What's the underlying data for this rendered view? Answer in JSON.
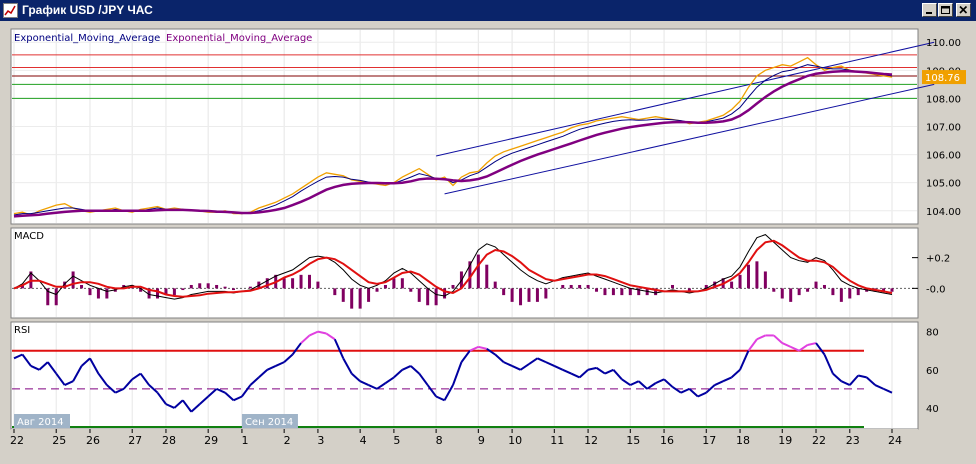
{
  "window": {
    "title": "График USD /JPY ЧАС",
    "buttons": [
      "minimize",
      "maximize",
      "close"
    ]
  },
  "chart_data": [
    {
      "panel": "price",
      "type": "line",
      "indicator_labels": [
        "Exponential_Moving_Average",
        "Exponential_Moving_Average"
      ],
      "label_colors": [
        "#000080",
        "#800080"
      ],
      "ylim": [
        103.6,
        110.4
      ],
      "yticks": [
        "110.00",
        "109.00",
        "108.00",
        "107.00",
        "106.00",
        "105.00",
        "104.00"
      ],
      "last_price": "108.76",
      "x_index_range": [
        0,
        104
      ],
      "series": [
        {
          "name": "price",
          "color": "#f0a000",
          "values": [
            103.9,
            103.95,
            103.85,
            104.0,
            104.1,
            104.2,
            104.25,
            104.1,
            104.0,
            103.95,
            104.0,
            104.05,
            104.1,
            104.0,
            103.95,
            104.05,
            104.1,
            104.15,
            104.05,
            104.1,
            104.05,
            104.0,
            104.0,
            103.95,
            103.95,
            104.0,
            103.9,
            103.9,
            103.95,
            104.1,
            104.2,
            104.3,
            104.45,
            104.6,
            104.8,
            105.0,
            105.2,
            105.35,
            105.3,
            105.25,
            105.1,
            105.05,
            105.0,
            104.95,
            104.9,
            105.0,
            105.2,
            105.35,
            105.5,
            105.3,
            105.1,
            105.2,
            104.9,
            105.2,
            105.35,
            105.4,
            105.7,
            105.95,
            106.1,
            106.2,
            106.3,
            106.4,
            106.5,
            106.6,
            106.7,
            106.8,
            106.95,
            107.05,
            107.1,
            107.2,
            107.25,
            107.3,
            107.35,
            107.3,
            107.25,
            107.3,
            107.35,
            107.3,
            107.25,
            107.2,
            107.1,
            107.15,
            107.2,
            107.3,
            107.4,
            107.6,
            107.9,
            108.4,
            108.8,
            109.0,
            109.1,
            109.2,
            109.15,
            109.3,
            109.45,
            109.2,
            109.0,
            109.1,
            109.15,
            109.0,
            108.95,
            108.9,
            108.85,
            108.8,
            108.76
          ]
        },
        {
          "name": "",
          "color": "#000080",
          "values": [
            103.85,
            103.9,
            103.9,
            103.95,
            104.0,
            104.05,
            104.1,
            104.1,
            104.05,
            104.0,
            104.0,
            104.0,
            104.05,
            104.0,
            104.0,
            104.0,
            104.05,
            104.1,
            104.05,
            104.05,
            104.05,
            104.0,
            104.0,
            103.98,
            103.95,
            103.95,
            103.92,
            103.9,
            103.93,
            104.0,
            104.1,
            104.2,
            104.35,
            104.5,
            104.7,
            104.88,
            105.05,
            105.2,
            105.22,
            105.2,
            105.12,
            105.08,
            105.02,
            104.98,
            104.95,
            104.98,
            105.08,
            105.2,
            105.32,
            105.25,
            105.15,
            105.15,
            105.0,
            105.1,
            105.25,
            105.35,
            105.55,
            105.75,
            105.92,
            106.05,
            106.15,
            106.25,
            106.35,
            106.45,
            106.55,
            106.65,
            106.78,
            106.9,
            106.98,
            107.05,
            107.12,
            107.18,
            107.22,
            107.24,
            107.22,
            107.23,
            107.26,
            107.26,
            107.24,
            107.21,
            107.15,
            107.14,
            107.17,
            107.23,
            107.3,
            107.45,
            107.68,
            108.05,
            108.4,
            108.65,
            108.82,
            108.95,
            109.0,
            109.1,
            109.2,
            109.15,
            109.08,
            109.05,
            109.05,
            109.0,
            108.95,
            108.92,
            108.88,
            108.85,
            108.8
          ]
        },
        {
          "name": "",
          "color": "#800080",
          "values": [
            103.8,
            103.82,
            103.84,
            103.86,
            103.9,
            103.93,
            103.96,
            103.98,
            104.0,
            104.0,
            104.0,
            104.0,
            104.0,
            104.0,
            104.0,
            104.0,
            104.0,
            104.02,
            104.03,
            104.03,
            104.03,
            104.02,
            104.0,
            103.99,
            103.97,
            103.96,
            103.94,
            103.92,
            103.92,
            103.94,
            103.98,
            104.03,
            104.1,
            104.2,
            104.32,
            104.45,
            104.6,
            104.75,
            104.85,
            104.92,
            104.96,
            104.98,
            104.99,
            104.99,
            104.98,
            104.98,
            105.0,
            105.05,
            105.12,
            105.15,
            105.14,
            105.12,
            105.08,
            105.06,
            105.08,
            105.13,
            105.22,
            105.36,
            105.5,
            105.64,
            105.77,
            105.89,
            106.0,
            106.1,
            106.2,
            106.3,
            106.4,
            106.5,
            106.6,
            106.7,
            106.78,
            106.85,
            106.92,
            106.98,
            107.02,
            107.06,
            107.1,
            107.13,
            107.15,
            107.16,
            107.15,
            107.13,
            107.13,
            107.15,
            107.18,
            107.25,
            107.38,
            107.58,
            107.82,
            108.05,
            108.25,
            108.42,
            108.56,
            108.68,
            108.8,
            108.88,
            108.92,
            108.95,
            108.97,
            108.97,
            108.95,
            108.93,
            108.9,
            108.87,
            108.85
          ]
        }
      ],
      "hlines": [
        {
          "value": 109.55,
          "color": "#e03030"
        },
        {
          "value": 109.1,
          "color": "#e03030"
        },
        {
          "value": 108.8,
          "color": "#800000"
        },
        {
          "value": 108.5,
          "color": "#20a020"
        },
        {
          "value": 108.0,
          "color": "#20a020"
        }
      ],
      "trendlines": [
        {
          "from": [
            50,
            105.95
          ],
          "to": [
            109,
            110.0
          ],
          "color": "#1010a0"
        },
        {
          "from": [
            51,
            104.6
          ],
          "to": [
            109,
            108.5
          ],
          "color": "#1010a0"
        }
      ]
    },
    {
      "panel": "macd",
      "type": "line",
      "label": "MACD",
      "ylim": [
        -0.18,
        0.38
      ],
      "yticks": [
        "+0.2",
        "-0.0"
      ],
      "series": [
        {
          "name": "",
          "color": "#000000",
          "values": [
            0.0,
            0.03,
            0.1,
            0.05,
            -0.02,
            -0.04,
            0.03,
            0.08,
            0.05,
            0.02,
            0.0,
            -0.02,
            -0.01,
            0.01,
            0.02,
            0.0,
            -0.04,
            -0.05,
            -0.06,
            -0.07,
            -0.06,
            -0.04,
            -0.03,
            -0.02,
            -0.02,
            -0.02,
            -0.03,
            -0.02,
            -0.01,
            0.02,
            0.05,
            0.08,
            0.1,
            0.12,
            0.16,
            0.2,
            0.21,
            0.2,
            0.17,
            0.12,
            0.06,
            0.02,
            0.0,
            0.02,
            0.05,
            0.1,
            0.13,
            0.1,
            0.05,
            0.0,
            -0.04,
            -0.05,
            -0.02,
            0.05,
            0.15,
            0.25,
            0.29,
            0.27,
            0.22,
            0.17,
            0.12,
            0.08,
            0.05,
            0.03,
            0.05,
            0.07,
            0.08,
            0.09,
            0.1,
            0.08,
            0.06,
            0.04,
            0.02,
            0.0,
            -0.01,
            -0.02,
            -0.03,
            -0.02,
            -0.01,
            -0.02,
            -0.03,
            -0.02,
            0.0,
            0.03,
            0.06,
            0.08,
            0.14,
            0.24,
            0.33,
            0.35,
            0.3,
            0.25,
            0.2,
            0.18,
            0.17,
            0.2,
            0.18,
            0.12,
            0.05,
            0.02,
            0.0,
            -0.01,
            -0.02,
            -0.03,
            -0.04
          ]
        },
        {
          "name": "",
          "color": "#e01010",
          "values": [
            0.0,
            0.02,
            0.05,
            0.05,
            0.03,
            0.01,
            0.01,
            0.03,
            0.04,
            0.04,
            0.03,
            0.01,
            0.0,
            0.0,
            0.01,
            0.01,
            -0.01,
            -0.02,
            -0.04,
            -0.05,
            -0.055,
            -0.05,
            -0.045,
            -0.035,
            -0.03,
            -0.025,
            -0.025,
            -0.02,
            -0.015,
            0.0,
            0.02,
            0.04,
            0.07,
            0.09,
            0.12,
            0.16,
            0.19,
            0.2,
            0.19,
            0.16,
            0.12,
            0.08,
            0.04,
            0.03,
            0.04,
            0.07,
            0.1,
            0.11,
            0.09,
            0.05,
            0.01,
            -0.02,
            -0.03,
            0.0,
            0.07,
            0.15,
            0.22,
            0.25,
            0.24,
            0.21,
            0.17,
            0.12,
            0.09,
            0.06,
            0.05,
            0.06,
            0.07,
            0.08,
            0.09,
            0.09,
            0.08,
            0.06,
            0.04,
            0.02,
            0.01,
            0.0,
            -0.01,
            -0.02,
            -0.02,
            -0.02,
            -0.02,
            -0.02,
            -0.01,
            0.01,
            0.03,
            0.06,
            0.1,
            0.17,
            0.25,
            0.3,
            0.31,
            0.28,
            0.24,
            0.2,
            0.18,
            0.18,
            0.17,
            0.14,
            0.09,
            0.05,
            0.02,
            0.0,
            -0.01,
            -0.02,
            -0.03
          ]
        }
      ],
      "histogram_color": "#800060",
      "zero_line_color": "#606060"
    },
    {
      "panel": "rsi",
      "type": "line",
      "label": "RSI",
      "ylim": [
        30,
        84
      ],
      "yticks": [
        "80",
        "60",
        "40"
      ],
      "series": [
        {
          "name": "",
          "color": "#0000a0",
          "overbought_color": "#e040e0",
          "values": [
            66,
            68,
            62,
            60,
            64,
            58,
            52,
            54,
            62,
            66,
            58,
            52,
            48,
            50,
            55,
            58,
            52,
            48,
            42,
            40,
            44,
            38,
            42,
            46,
            50,
            48,
            44,
            46,
            52,
            56,
            60,
            62,
            64,
            68,
            74,
            78,
            80,
            79,
            76,
            66,
            58,
            54,
            52,
            50,
            53,
            56,
            60,
            62,
            58,
            52,
            46,
            44,
            52,
            64,
            70,
            72,
            71,
            68,
            64,
            62,
            60,
            63,
            66,
            64,
            62,
            60,
            58,
            56,
            60,
            61,
            58,
            60,
            55,
            52,
            54,
            50,
            53,
            55,
            51,
            48,
            50,
            46,
            48,
            52,
            54,
            56,
            60,
            70,
            76,
            78,
            78,
            74,
            72,
            70,
            73,
            74,
            68,
            58,
            54,
            52,
            57,
            56,
            52,
            50,
            48
          ]
        }
      ],
      "levels": [
        {
          "value": 70,
          "color": "#e01010",
          "style": "solid"
        },
        {
          "value": 50,
          "color": "#800080",
          "style": "dashed"
        },
        {
          "value": 30,
          "color": "#108010",
          "style": "solid"
        }
      ]
    }
  ],
  "x_axis": {
    "month_labels": [
      {
        "text": "Авг 2014",
        "at": 0
      },
      {
        "text": "Сен 2014",
        "at": 27
      }
    ],
    "ticks": [
      {
        "text": "22",
        "at": 0
      },
      {
        "text": "25",
        "at": 5
      },
      {
        "text": "26",
        "at": 9
      },
      {
        "text": "27",
        "at": 14
      },
      {
        "text": "28",
        "at": 18
      },
      {
        "text": "29",
        "at": 23
      },
      {
        "text": "1",
        "at": 27
      },
      {
        "text": "2",
        "at": 32
      },
      {
        "text": "3",
        "at": 36
      },
      {
        "text": "4",
        "at": 41
      },
      {
        "text": "5",
        "at": 45
      },
      {
        "text": "8",
        "at": 50
      },
      {
        "text": "9",
        "at": 55
      },
      {
        "text": "10",
        "at": 59
      },
      {
        "text": "11",
        "at": 64
      },
      {
        "text": "12",
        "at": 68
      },
      {
        "text": "15",
        "at": 73
      },
      {
        "text": "16",
        "at": 77
      },
      {
        "text": "17",
        "at": 82
      },
      {
        "text": "18",
        "at": 86
      },
      {
        "text": "19",
        "at": 91
      },
      {
        "text": "22",
        "at": 95
      },
      {
        "text": "23",
        "at": 99
      },
      {
        "text": "24",
        "at": 104
      }
    ]
  }
}
